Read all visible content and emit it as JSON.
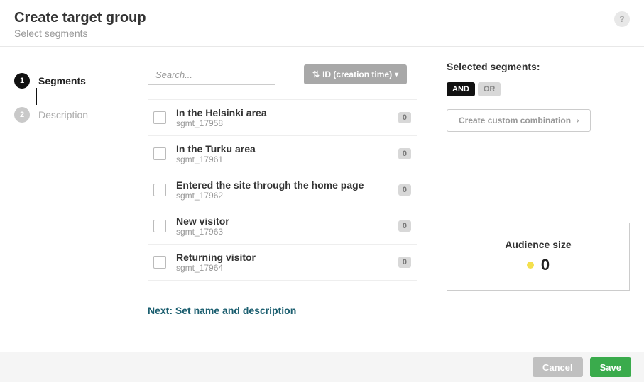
{
  "header": {
    "title": "Create target group",
    "subtitle": "Select segments",
    "help": "?"
  },
  "stepper": {
    "steps": [
      {
        "num": "1",
        "label": "Segments"
      },
      {
        "num": "2",
        "label": "Description"
      }
    ]
  },
  "center": {
    "search_placeholder": "Search...",
    "sort_label": "ID (creation time)",
    "segments": [
      {
        "name": "In the Helsinki area",
        "id": "sgmt_17958",
        "count": "0"
      },
      {
        "name": "In the Turku area",
        "id": "sgmt_17961",
        "count": "0"
      },
      {
        "name": "Entered the site through the home page",
        "id": "sgmt_17962",
        "count": "0"
      },
      {
        "name": "New visitor",
        "id": "sgmt_17963",
        "count": "0"
      },
      {
        "name": "Returning visitor",
        "id": "sgmt_17964",
        "count": "0"
      }
    ],
    "next_link": "Next: Set name and description"
  },
  "right": {
    "title": "Selected segments:",
    "and": "AND",
    "or": "OR",
    "custom": "Create custom combination",
    "audience_title": "Audience size",
    "audience_value": "0"
  },
  "footer": {
    "cancel": "Cancel",
    "save": "Save"
  }
}
